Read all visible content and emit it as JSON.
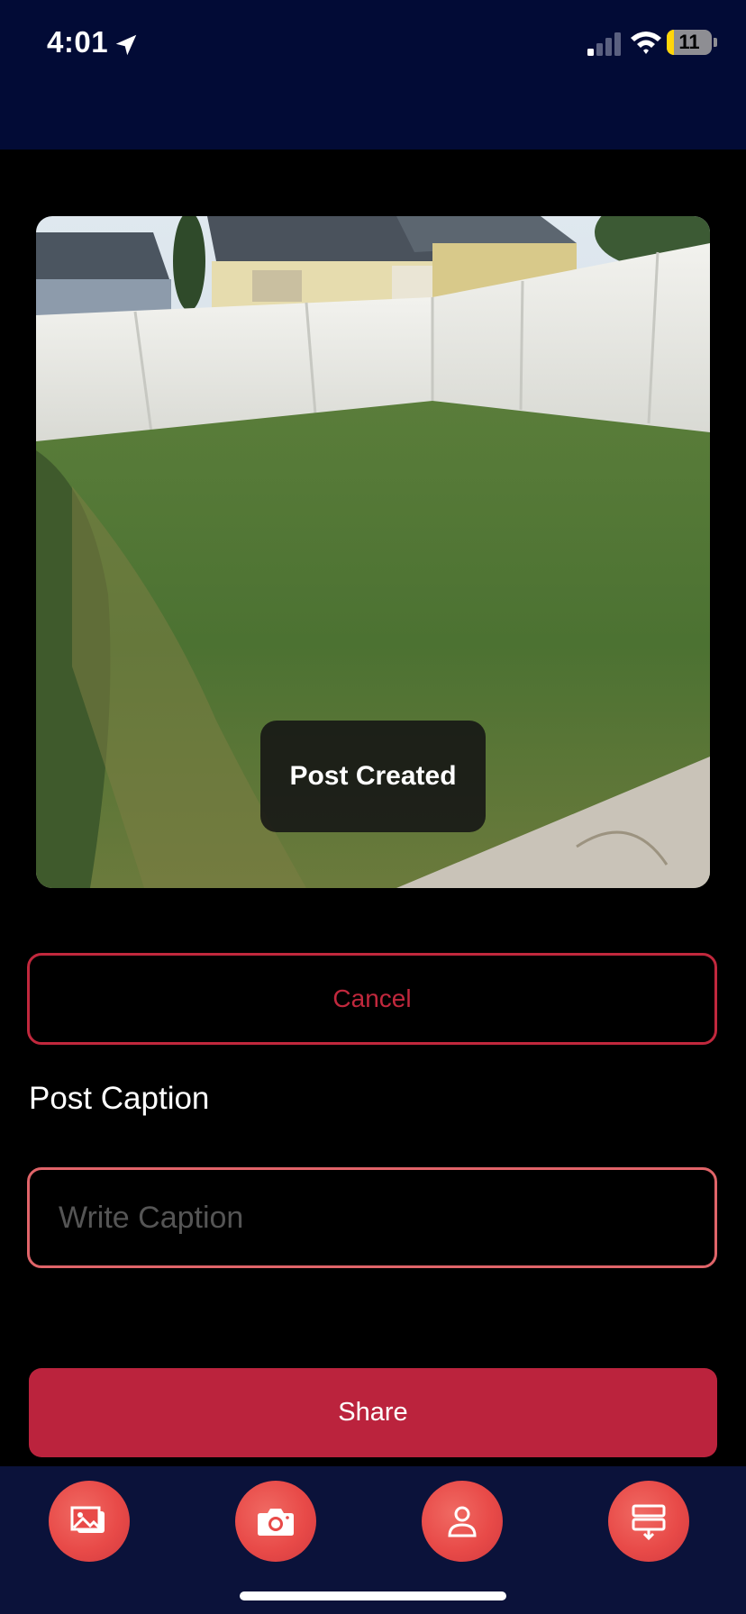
{
  "status_bar": {
    "time": "4:01",
    "battery_level": "11",
    "icons": [
      "location-arrow-icon",
      "cellular-signal-icon",
      "wifi-icon",
      "battery-icon"
    ]
  },
  "photo": {
    "subject": "backyard-lawn-photo"
  },
  "toast": {
    "message": "Post Created"
  },
  "actions": {
    "cancel_label": "Cancel",
    "share_label": "Share"
  },
  "caption": {
    "label": "Post Caption",
    "placeholder": "Write Caption",
    "value": ""
  },
  "tab_bar": {
    "icons": [
      "gallery-icon",
      "camera-icon",
      "profile-icon",
      "feed-download-icon"
    ]
  },
  "colors": {
    "header_background": "#020b36",
    "tab_bar_background": "#0b123a",
    "accent": "#bb233d",
    "input_border": "#e06469",
    "tab_button": "#e84a48"
  }
}
